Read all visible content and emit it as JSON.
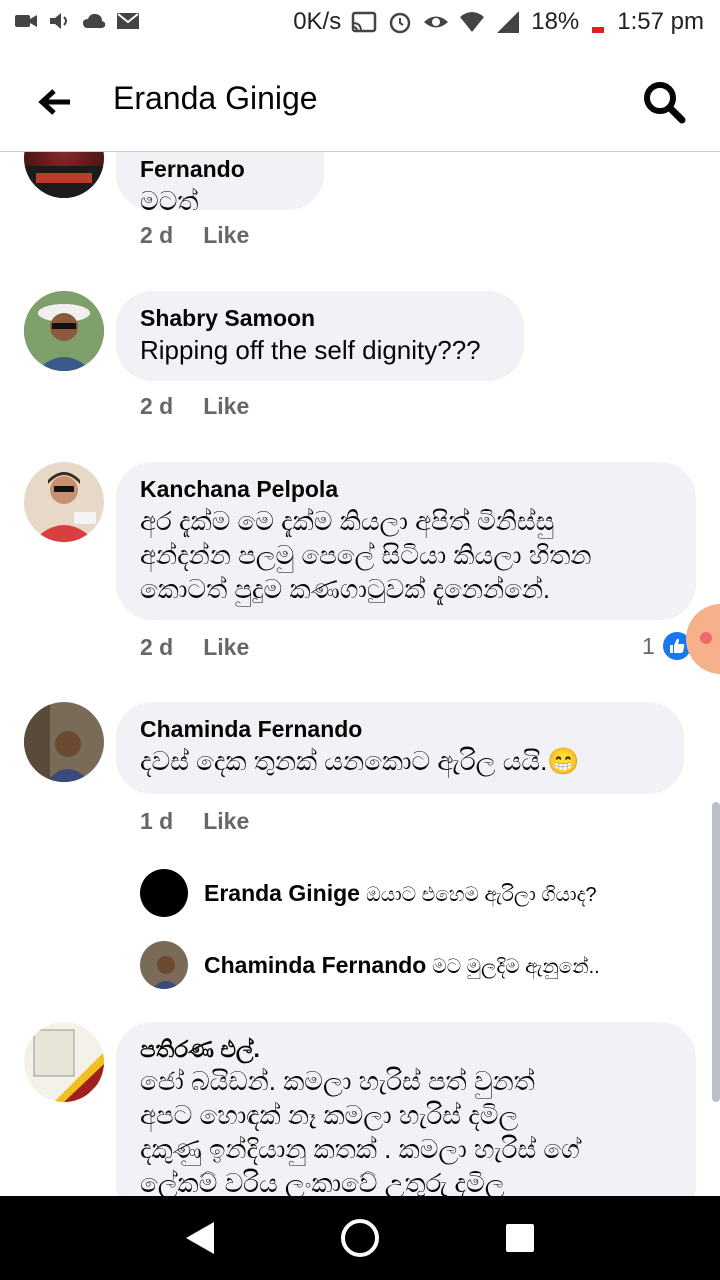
{
  "status_bar": {
    "net_speed": "0K/s",
    "battery": "18%",
    "time": "1:57 pm"
  },
  "app_bar": {
    "title": "Eranda Ginige",
    "back_icon": "arrow-left-icon",
    "search_icon": "search-icon"
  },
  "comments": [
    {
      "name": "Sunil Fernando",
      "text": "මටත්",
      "time": "2 d",
      "like_label": "Like"
    },
    {
      "name": "Shabry Samoon",
      "text": "Ripping off the self dignity???",
      "time": "2 d",
      "like_label": "Like"
    },
    {
      "name": "Kanchana Pelpola",
      "lines": [
        "අර දැක්ම මෙ දැක්ම කියලා අපිත් මිනිස්සු",
        "අන්දන්න පලමු පෙලේ සිටියා කියලා හිතන",
        "කොටත් පුදුම කණගාටුවක් දැනෙන්නේ."
      ],
      "time": "2 d",
      "like_label": "Like",
      "reaction_count": "1"
    },
    {
      "name": "Chaminda Fernando",
      "text": "දවස් දෙක තුනක් යනකොට ඇරිල යයි.😁",
      "time": "1 d",
      "like_label": "Like"
    },
    {
      "name": "පතිරණ එල්.",
      "lines": [
        "ජෝ බයිඩන්. කමලා හැරිස් පත් වුනත්",
        "අපට හොඳක් නෑ කමලා හැරිස් දමිල",
        "දකුණු ඉන්දියානු කතක් . කමලා හැරිස් ගේ",
        "ලේකම් වරිය ලංකාවේ උතුරු දමිල"
      ]
    }
  ],
  "replies": [
    {
      "name": "Eranda Ginige",
      "text": "ඔයාට එහෙම ඇරිලා ගියාද?"
    },
    {
      "name": "Chaminda Fernando",
      "text": "මට මුලදිම ඇනුනේ.."
    }
  ],
  "colors": {
    "bubble": "#f0f2f5",
    "meta": "#65676b",
    "like_blue": "#1877f2",
    "divider": "#cfd1d5"
  }
}
